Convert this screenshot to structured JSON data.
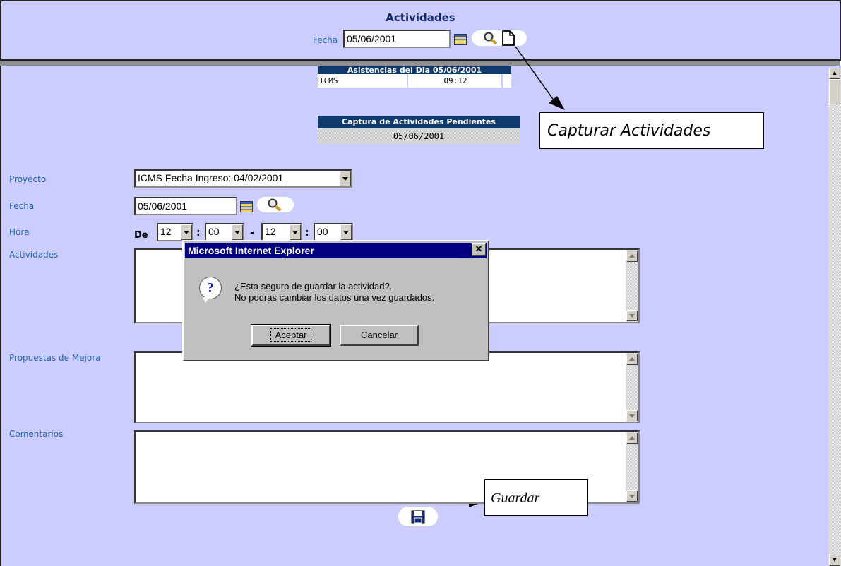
{
  "top": {
    "title": "Actividades",
    "fecha_label": "Fecha",
    "fecha_value": "05/06/2001"
  },
  "asistencias": {
    "header": "Asistencias del Dia 05/06/2001",
    "rows": [
      {
        "project": "ICMS",
        "time": "09:12"
      }
    ]
  },
  "captura": {
    "header": "Captura de Actividades Pendientes",
    "date": "05/06/2001"
  },
  "form": {
    "proyecto_label": "Proyecto",
    "proyecto_value": "ICMS Fecha Ingreso: 04/02/2001",
    "fecha_label": "Fecha",
    "fecha_value": "05/06/2001",
    "hora_label": "Hora",
    "de_label": "De",
    "hour_from": "12",
    "min_from": "00",
    "hour_to": "12",
    "min_to": "00",
    "sep1": ":",
    "sep2": "-",
    "sep3": ":",
    "actividades_label": "Actividades",
    "propuestas_label": "Propuestas de Mejora",
    "comentarios_label": "Comentarios"
  },
  "callouts": {
    "capturar": "Capturar Actividades",
    "guardar": "Guardar"
  },
  "dialog": {
    "title": "Microsoft Internet Explorer",
    "line1": "¿Esta seguro de guardar la actividad?.",
    "line2": "No podras cambiar los datos una vez guardados.",
    "ok": "Aceptar",
    "cancel": "Cancelar",
    "icon": "question-icon"
  }
}
